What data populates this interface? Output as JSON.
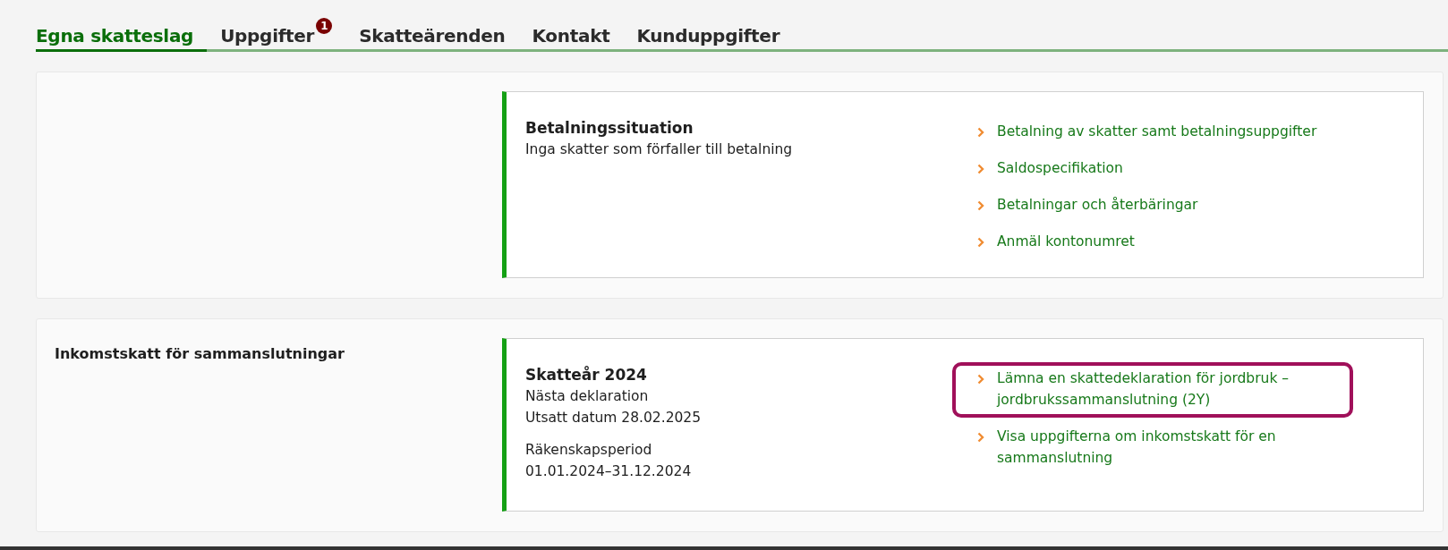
{
  "tabs": [
    {
      "label": "Egna skatteslag",
      "selected": true
    },
    {
      "label": "Uppgifter",
      "selected": false,
      "badge": "1"
    },
    {
      "label": "Skatteärenden",
      "selected": false
    },
    {
      "label": "Kontakt",
      "selected": false
    },
    {
      "label": "Kunduppgifter",
      "selected": false
    }
  ],
  "sections": [
    {
      "info": {
        "heading": "Betalningssituation",
        "groups": [
          [
            "Inga skatter som förfaller till betalning"
          ]
        ]
      },
      "links": [
        {
          "label": "Betalning av skatter samt betalningsuppgifter",
          "highlighted": false
        },
        {
          "label": "Saldospecifikation",
          "highlighted": false
        },
        {
          "label": "Betalningar och återbäringar",
          "highlighted": false
        },
        {
          "label": "Anmäl kontonumret",
          "highlighted": false
        }
      ]
    },
    {
      "title": "Inkomstskatt för sammanslutningar",
      "info": {
        "heading": "Skatteår 2024",
        "groups": [
          [
            "Nästa deklaration",
            "Utsatt datum 28.02.2025"
          ],
          [
            "Räkenskapsperiod",
            "01.01.2024–31.12.2024"
          ]
        ]
      },
      "links": [
        {
          "label": "Lämna en skattedeklaration för jordbruk – jordbrukssammanslutning (2Y)",
          "highlighted": true
        },
        {
          "label": "Visa uppgifterna om inkomstskatt för en sammanslutning",
          "highlighted": false
        }
      ]
    }
  ]
}
